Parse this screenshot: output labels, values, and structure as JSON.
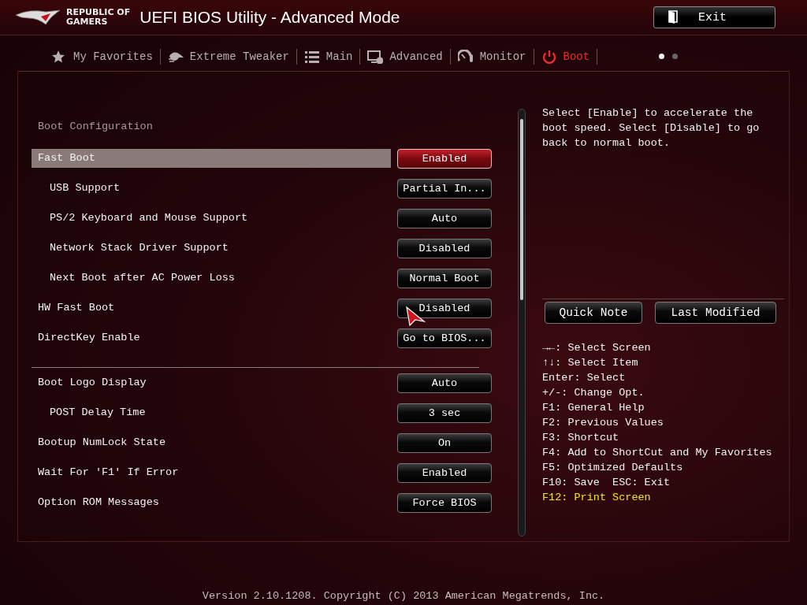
{
  "header": {
    "logo_lines": [
      "REPUBLIC OF",
      "GAMERS"
    ],
    "title": "UEFI BIOS Utility - Advanced Mode",
    "exit_button": "Exit"
  },
  "tabs": [
    {
      "label": "My Favorites",
      "selected": false
    },
    {
      "label": "Extreme Tweaker",
      "selected": false
    },
    {
      "label": "Main",
      "selected": false
    },
    {
      "label": "Advanced",
      "selected": false
    },
    {
      "label": "Monitor",
      "selected": false
    },
    {
      "label": "Boot",
      "selected": true
    }
  ],
  "page_dots": [
    {
      "selected": true
    },
    {
      "selected": false
    }
  ],
  "section_title": "Boot Configuration",
  "groups": [
    [
      {
        "label": "Fast Boot",
        "value": "Enabled",
        "indented": false,
        "selected": true
      },
      {
        "label": "USB Support",
        "value": "Partial In...",
        "indented": true,
        "selected": false
      },
      {
        "label": "PS/2 Keyboard and Mouse Support",
        "value": "Auto",
        "indented": true,
        "selected": false
      },
      {
        "label": "Network Stack Driver Support",
        "value": "Disabled",
        "indented": true,
        "selected": false
      },
      {
        "label": "Next Boot after AC Power Loss",
        "value": "Normal Boot",
        "indented": true,
        "selected": false
      },
      {
        "label": "HW Fast Boot",
        "value": "Disabled",
        "indented": false,
        "selected": false
      },
      {
        "label": "DirectKey Enable",
        "value": "Go to BIOS...",
        "indented": false,
        "selected": false
      }
    ],
    [
      {
        "label": "Boot Logo Display",
        "value": "Auto",
        "indented": false,
        "selected": false
      },
      {
        "label": "POST Delay Time",
        "value": "3 sec",
        "indented": true,
        "selected": false
      },
      {
        "label": "Bootup NumLock State",
        "value": "On",
        "indented": false,
        "selected": false
      },
      {
        "label": "Wait For 'F1' If Error",
        "value": "Enabled",
        "indented": false,
        "selected": false
      },
      {
        "label": "Option ROM Messages",
        "value": "Force BIOS",
        "indented": false,
        "selected": false
      }
    ]
  ],
  "help_text": "Select [Enable] to accelerate the boot speed. Select [Disable] to go back to normal boot.",
  "panel_buttons": [
    "Quick Note",
    "Last Modified"
  ],
  "key_hints": [
    {
      "text": "→←: Select Screen",
      "highlighted": false
    },
    {
      "text": "↑↓: Select Item",
      "highlighted": false
    },
    {
      "text": "Enter: Select",
      "highlighted": false
    },
    {
      "text": "+/-: Change Opt.",
      "highlighted": false
    },
    {
      "text": "F1: General Help",
      "highlighted": false
    },
    {
      "text": "F2: Previous Values",
      "highlighted": false
    },
    {
      "text": "F3: Shortcut",
      "highlighted": false
    },
    {
      "text": "F4: Add to ShortCut and My Favorites",
      "highlighted": false
    },
    {
      "text": "F5: Optimized Defaults",
      "highlighted": false
    },
    {
      "text": "F10: Save  ESC: Exit",
      "highlighted": false
    },
    {
      "text": "F12: Print Screen",
      "highlighted": true
    }
  ],
  "footer": "Version 2.10.1208. Copyright (C) 2013 American Megatrends, Inc."
}
